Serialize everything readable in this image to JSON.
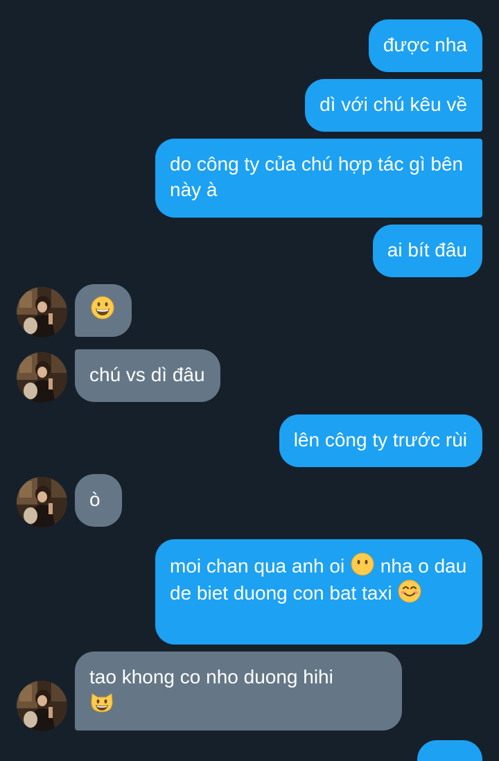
{
  "colors": {
    "background": "#16202b",
    "sent_bubble": "#1da1f2",
    "received_bubble": "#657786",
    "text": "#ffffff"
  },
  "messages": [
    {
      "direction": "sent",
      "text": "được nha"
    },
    {
      "direction": "sent",
      "text": "dì với chú kêu về"
    },
    {
      "direction": "sent",
      "text": "do công ty của chú hợp tác gì bên này à"
    },
    {
      "direction": "sent",
      "text": "ai bít đâu"
    },
    {
      "direction": "received",
      "text": "",
      "emoji": "grinning-face-emoji"
    },
    {
      "direction": "received",
      "text": "chú vs dì đâu"
    },
    {
      "direction": "sent",
      "text": "lên công ty trước rùi"
    },
    {
      "direction": "received",
      "text": "ò"
    },
    {
      "direction": "sent",
      "text_a": "moi chan qua anh oi",
      "emoji_a": "face-without-mouth-emoji",
      "text_b": "nha o dau de biet duong con bat taxi",
      "emoji_b": "smiling-face-with-smiling-eyes-emoji"
    },
    {
      "direction": "received",
      "text": "tao khong co nho duong hihi",
      "emoji": "grinning-cat-emoji"
    }
  ]
}
